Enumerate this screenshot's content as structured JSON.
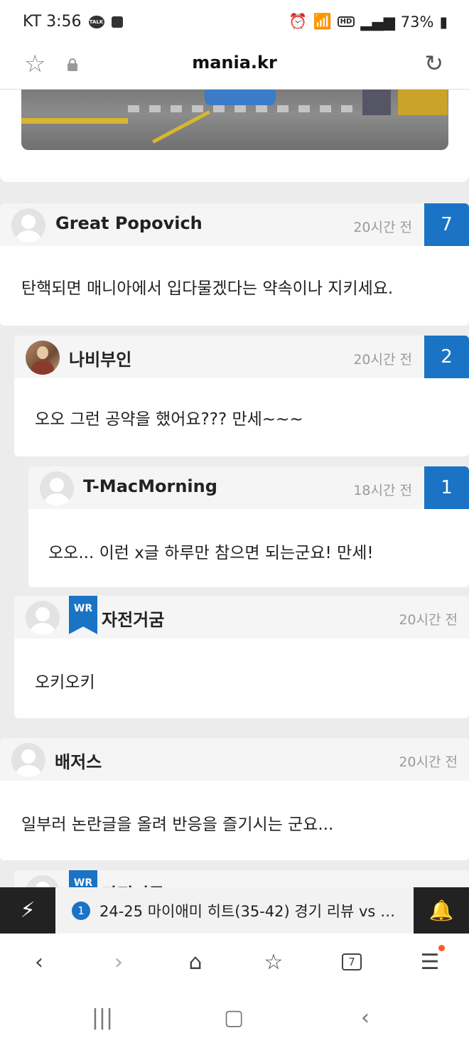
{
  "status_bar": {
    "carrier_time": "KT 3:56",
    "talk_label": "TALK",
    "hd_label": "HD",
    "battery": "73%"
  },
  "url_bar": {
    "url": "mania.kr"
  },
  "comments": [
    {
      "name": "Great Popovich",
      "time": "20시간 전",
      "count": "7",
      "body": "탄핵되면 매니아에서 입다물겠다는 약속이나 지키세요."
    },
    {
      "name": "나비부인",
      "time": "20시간 전",
      "count": "2",
      "body": "오오 그런 공약을 했어요??? 만세~~~"
    },
    {
      "name": "T-MacMorning",
      "time": "18시간 전",
      "count": "1",
      "body": "오오... 이런 x글 하루만 참으면 되는군요! 만세!"
    },
    {
      "name": "자전거굼",
      "time": "20시간 전",
      "badge": "WR",
      "body": "오키오키"
    },
    {
      "name": "배저스",
      "time": "20시간 전",
      "body": "일부러 논란글을 올려 반응을 즐기시는 군요..."
    },
    {
      "name": "자전거굼",
      "badge": "WR"
    }
  ],
  "notification": {
    "number": "1",
    "text": "24-25 마이애미 히트(35-42) 경기 리뷰 vs 그..."
  },
  "toolbar": {
    "tabs_count": "7"
  },
  "colors": {
    "accent": "#1a73c4",
    "notif_dot": "#ff5a1f"
  }
}
